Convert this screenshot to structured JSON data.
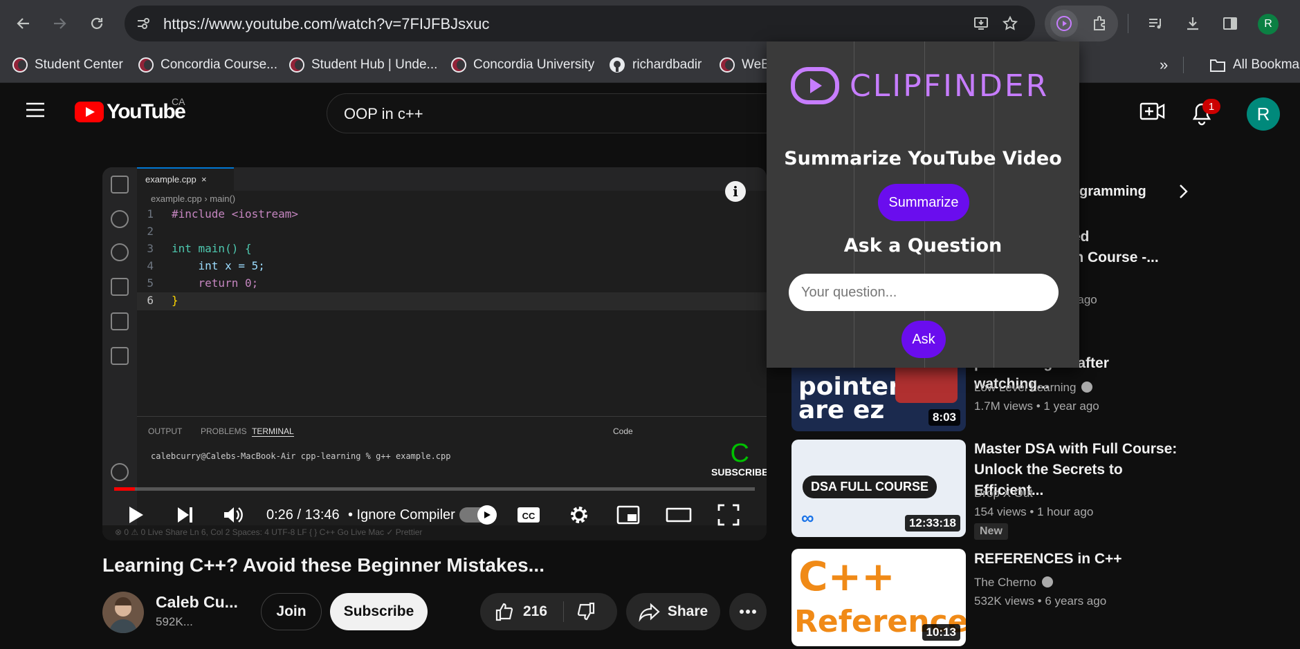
{
  "browser": {
    "url": "https://www.youtube.com/watch?v=7FIJFBJsxuc",
    "profile_initial": "R",
    "bookmarks": [
      "Student Center",
      "Concordia Course...",
      "Student Hub | Unde...",
      "Concordia University",
      "richardbadir",
      "WeB"
    ],
    "all_bookmarks_label": "All Bookmarks"
  },
  "youtube": {
    "logo_text": "YouTube",
    "country": "CA",
    "search_query": "OOP in c++",
    "notification_count": "1",
    "avatar_initial": "R"
  },
  "player": {
    "tab_file": "example.cpp",
    "breadcrumb": "example.cpp  ›  main()",
    "code_lines": [
      {
        "n": "1",
        "text": "#include <iostream>"
      },
      {
        "n": "2",
        "text": ""
      },
      {
        "n": "3",
        "text": "int main() {"
      },
      {
        "n": "4",
        "text": "    int x = 5;"
      },
      {
        "n": "5",
        "text": "    return 0;"
      },
      {
        "n": "6",
        "text": "}"
      }
    ],
    "panel_tabs": [
      "OUTPUT",
      "PROBLEMS",
      "TERMINAL"
    ],
    "terminal_line": "calebcurry@Calebs-MacBook-Air cpp-learning % g++ example.cpp",
    "terminal_kind": "Code",
    "subscribe_overlay": "SUBSCRIBE",
    "status_bar": "⊗ 0 ⚠ 0   Live Share          Ln 6, Col 2   Spaces: 4   UTF-8   LF   { } C++   Go Live   Mac   ✓ Prettier",
    "time": "0:26 / 13:46",
    "chapter": "• Ignore Compiler",
    "progress_fraction": 0.032
  },
  "video": {
    "title": "Learning C++? Avoid these Beginner Mistakes...",
    "channel_name": "Caleb Cu...",
    "channel_subs": "592K...",
    "join_label": "Join",
    "subscribe_label": "Subscribe",
    "likes": "216",
    "share_label": "Share"
  },
  "sidebar": {
    "chip_partial": "rogramming",
    "recommendations": [
      {
        "title_partial": "nted\nash Course -...",
        "meta_partial": "ths ago"
      },
      {
        "title": "k about\npointers again after watching...",
        "channel": "Low Level Learning",
        "views": "1.7M views • 1 year ago",
        "duration": "8:03",
        "thumb_text": "pointers\nare ez"
      },
      {
        "title": "Master DSA with Full Course:\nUnlock the Secrets to Efficient...",
        "channel": "Drop X Out",
        "views": "154 views • 1 hour ago",
        "duration": "12:33:18",
        "badge": "New",
        "thumb_text": "DSA FULL COURSE"
      },
      {
        "title": "REFERENCES in C++",
        "channel": "The Cherno",
        "views": "532K views • 6 years ago",
        "duration": "10:13",
        "thumb_text_1": "C++",
        "thumb_text_2": "References"
      }
    ]
  },
  "clipfinder": {
    "brand": "CLIPFINDER",
    "heading_summarize": "Summarize YouTube Video",
    "summarize_button": "Summarize",
    "heading_ask": "Ask a Question",
    "question_placeholder": "Your question...",
    "ask_button": "Ask",
    "accent": "#6a0dee",
    "logo_color": "#c77dff"
  }
}
